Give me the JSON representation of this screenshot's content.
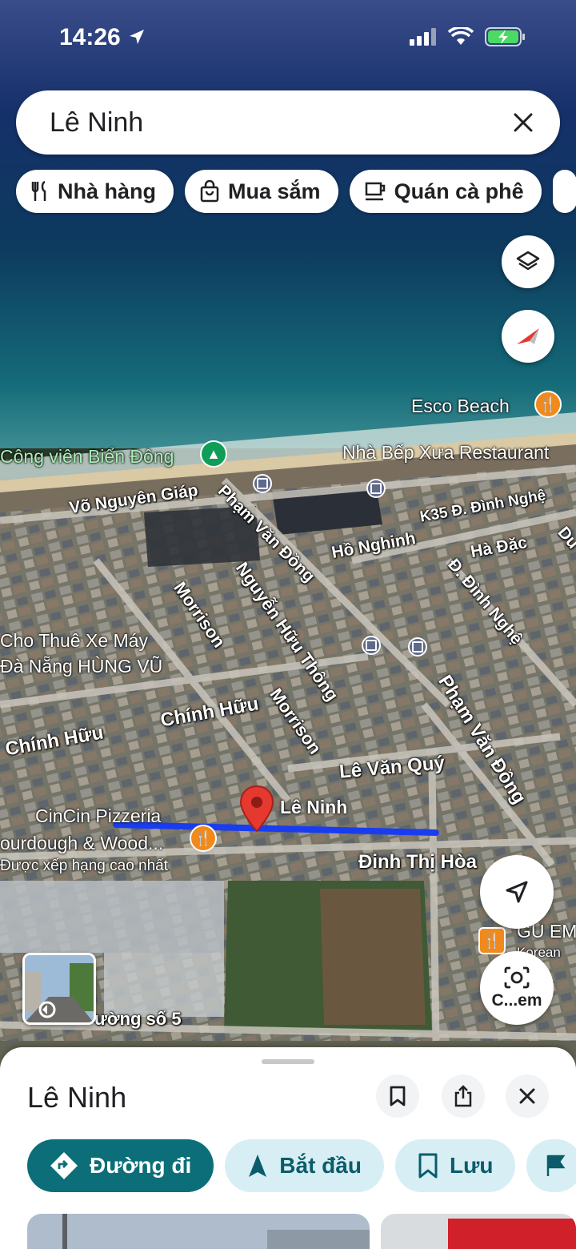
{
  "status_bar": {
    "time": "14:26"
  },
  "search": {
    "value": "Lê Ninh"
  },
  "chips": [
    {
      "label": "Nhà hàng",
      "icon": "fork-knife-icon"
    },
    {
      "label": "Mua sắm",
      "icon": "shopping-bag-icon"
    },
    {
      "label": "Quán cà phê",
      "icon": "coffee-cup-icon"
    }
  ],
  "map": {
    "pois": {
      "esco_beach": "Esco Beach",
      "cong_vien": "Công viên Biển Đông",
      "nha_bep_xua": "Nhà Bếp Xưa Restaurant",
      "cho_thue_1": "Cho Thuê Xe Máy",
      "cho_thue_2": "Đà Nẵng HÙNG VŨ",
      "cincin_1": "CinCin Pizzeria",
      "cincin_2": "ourdough & Wood...",
      "cincin_3": "Được xếp hạng cao nhất",
      "gu_em_1": "GU EM",
      "gu_em_2": "Korean",
      "le_ninh_pin": "Lê Ninh"
    },
    "streets": {
      "vo_nguyen_giap": "Võ Nguyên Giáp",
      "pham_van_dong_1": "Phạm Văn Đồng",
      "pham_van_dong_2": "Phạm Văn Đồng",
      "ho_nghinh": "Hồ Nghinh",
      "k35": "K35 Đ. Đình Nghệ",
      "ha_dac": "Hà Đặc",
      "dinh_nghe": "Đ. Đình Nghệ",
      "du": "Du",
      "morrison_1": "Morrison",
      "morrison_2": "Morrison",
      "nguyen_huu_thong": "Nguyễn Hữu Thông",
      "chinh_huu_1": "Chính Hữu",
      "chinh_huu_2": "Chính Hữu",
      "le_van_quy": "Lê Văn Quý",
      "dinh_thi_hoa": "Đinh Thị Hòa",
      "duong_so_5": "ường số 5"
    }
  },
  "controls": {
    "camera_label": "C...em"
  },
  "sheet": {
    "title": "Lê Ninh",
    "actions": [
      {
        "label": "Đường đi",
        "icon": "directions-icon"
      },
      {
        "label": "Bắt đầu",
        "icon": "navigation-arrow-icon"
      },
      {
        "label": "Lưu",
        "icon": "bookmark-icon"
      }
    ]
  },
  "colors": {
    "route": "#1a3cf0",
    "pin": "#e5392f",
    "primary_action": "#0b6e78",
    "secondary_action": "#d7eef4"
  }
}
